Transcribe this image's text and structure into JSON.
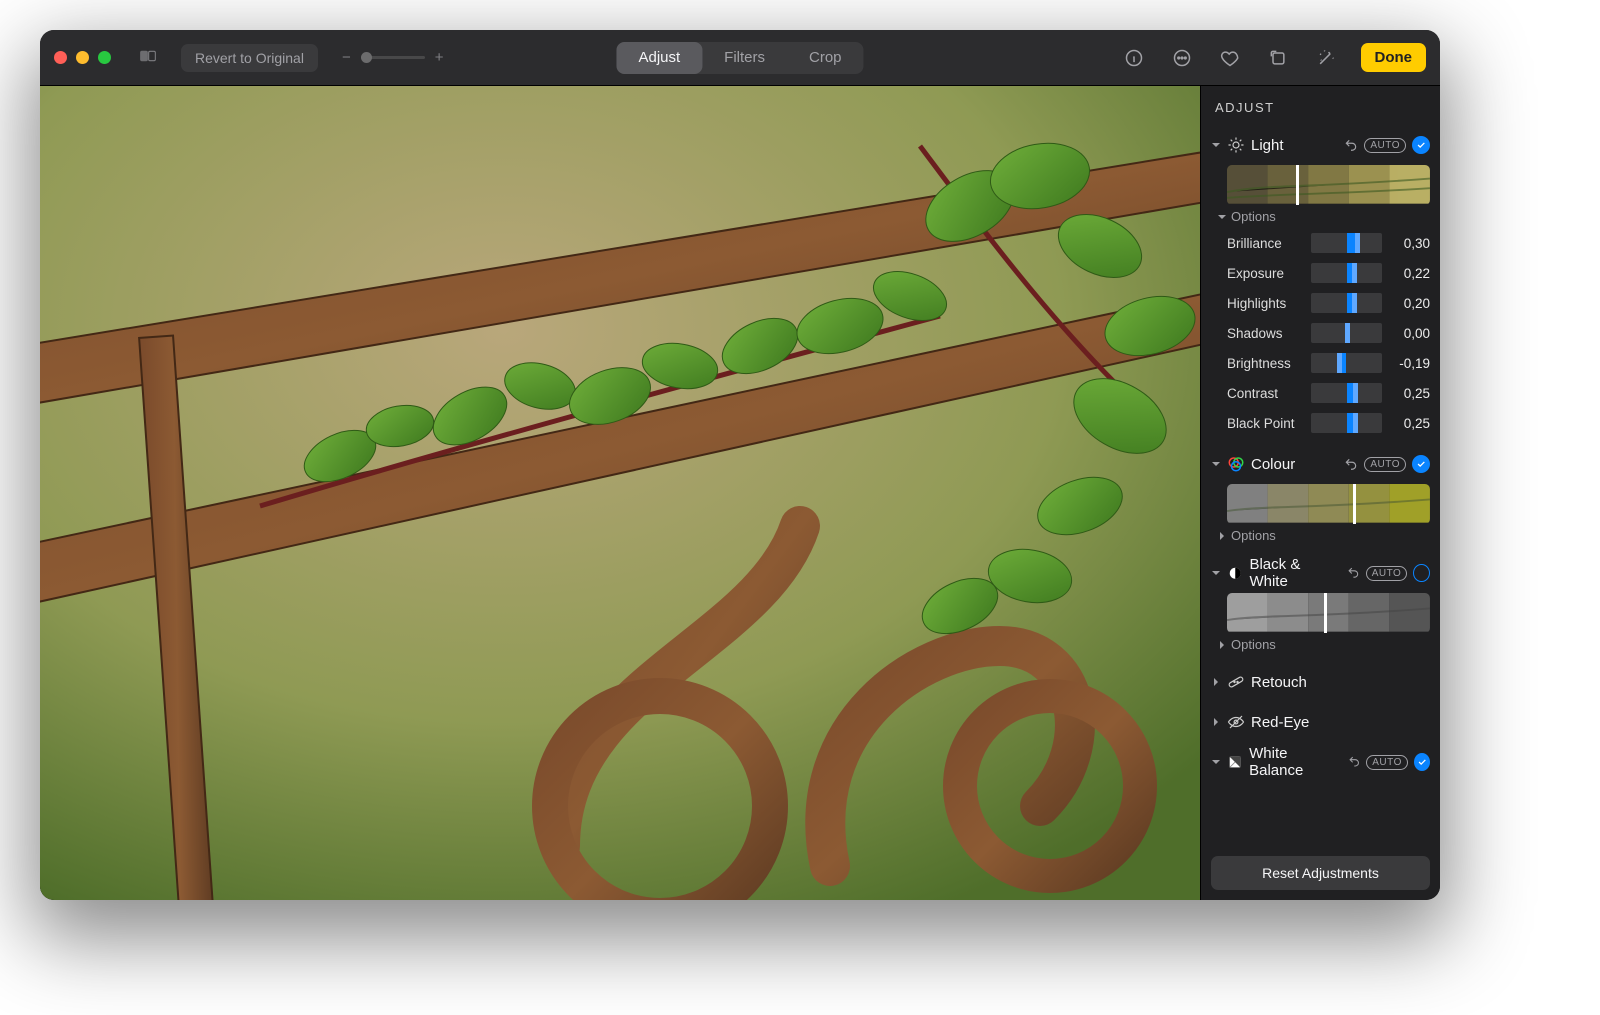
{
  "toolbar": {
    "revert_label": "Revert to Original",
    "zoom_minus": "−",
    "zoom_plus": "+",
    "tabs": {
      "adjust": "Adjust",
      "filters": "Filters",
      "crop": "Crop"
    },
    "done_label": "Done"
  },
  "sidebar": {
    "header": "ADJUST",
    "light": {
      "title": "Light",
      "auto": "AUTO",
      "options_label": "Options",
      "filmstrip_tick_pct": 34,
      "sliders": [
        {
          "label": "Brilliance",
          "value": "0,30",
          "pct": 65,
          "center": 50
        },
        {
          "label": "Exposure",
          "value": "0,22",
          "pct": 61,
          "center": 50
        },
        {
          "label": "Highlights",
          "value": "0,20",
          "pct": 60,
          "center": 50
        },
        {
          "label": "Shadows",
          "value": "0,00",
          "pct": 50,
          "center": 50
        },
        {
          "label": "Brightness",
          "value": "-0,19",
          "pct": 40,
          "center": 50
        },
        {
          "label": "Contrast",
          "value": "0,25",
          "pct": 62,
          "center": 50
        },
        {
          "label": "Black Point",
          "value": "0,25",
          "pct": 62,
          "center": 50
        }
      ]
    },
    "colour": {
      "title": "Colour",
      "auto": "AUTO",
      "options_label": "Options",
      "filmstrip_tick_pct": 62
    },
    "bw": {
      "title": "Black & White",
      "auto": "AUTO",
      "options_label": "Options",
      "filmstrip_tick_pct": 48
    },
    "retouch": {
      "title": "Retouch"
    },
    "redeye": {
      "title": "Red-Eye"
    },
    "wb": {
      "title": "White Balance",
      "auto": "AUTO"
    },
    "reset_label": "Reset Adjustments"
  }
}
